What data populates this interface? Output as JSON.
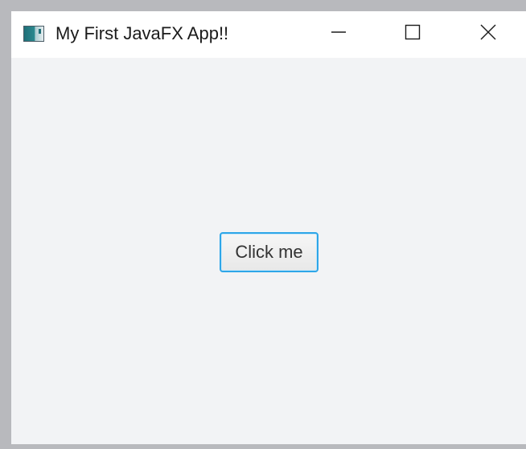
{
  "window": {
    "title": "My First JavaFX App!!",
    "controls": {
      "minimize": "minimize-icon",
      "maximize": "maximize-icon",
      "close": "close-icon"
    }
  },
  "content": {
    "button_label": "Click me"
  },
  "colors": {
    "window_background": "#f2f3f5",
    "titlebar_background": "#ffffff",
    "button_focus_border": "#2ea6e8",
    "outer_frame": "#b8b9bd"
  }
}
